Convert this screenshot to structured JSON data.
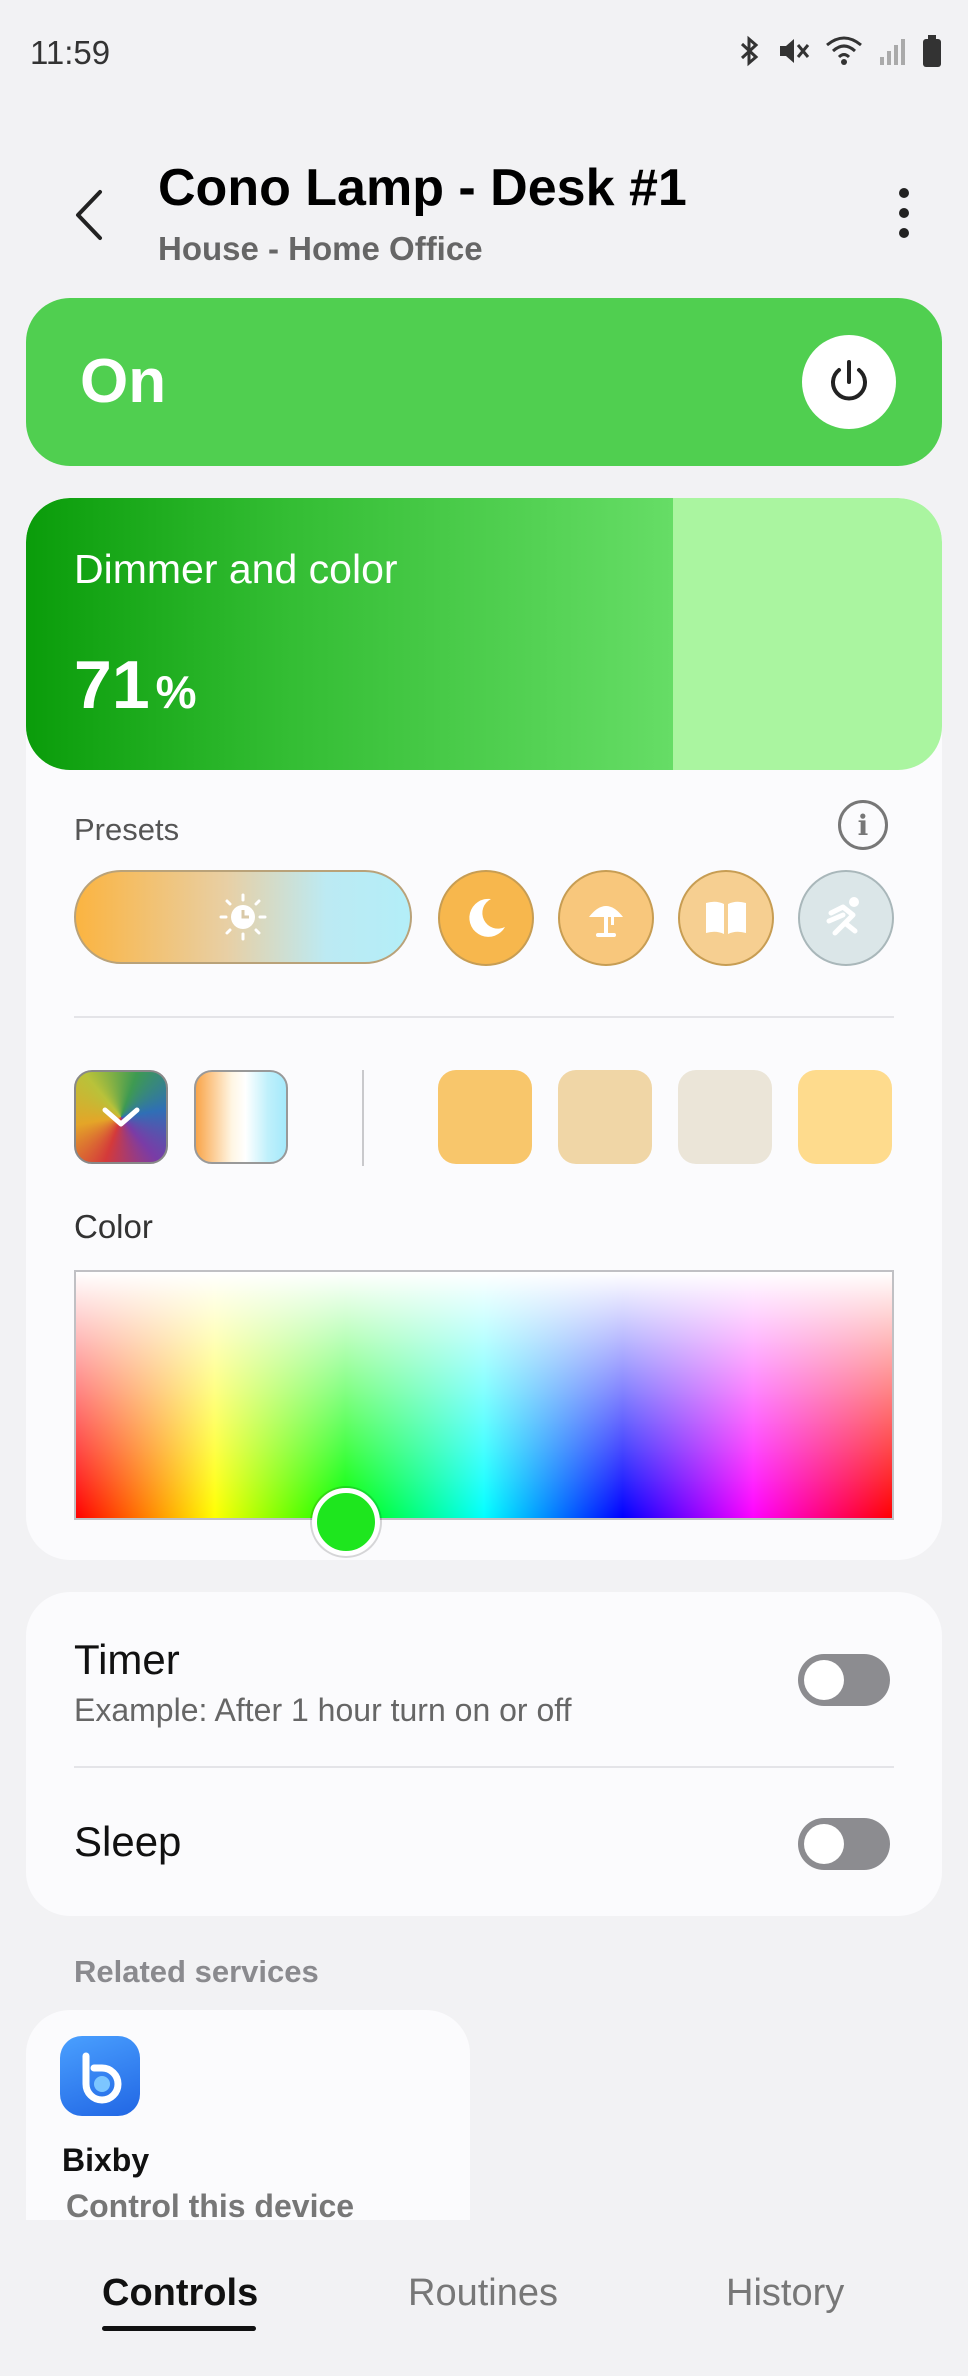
{
  "status_bar": {
    "time": "11:59",
    "icons": [
      "bluetooth-icon",
      "mute-icon",
      "wifi-icon",
      "signal-icon",
      "battery-icon"
    ]
  },
  "header": {
    "title": "Cono Lamp - Desk #1",
    "subtitle": "House - Home Office"
  },
  "power": {
    "state_label": "On",
    "accent_color": "#50cf50"
  },
  "dimmer": {
    "label": "Dimmer and color",
    "value": "71",
    "unit": "%",
    "level_fraction": 0.71
  },
  "presets": {
    "label": "Presets",
    "items": [
      {
        "icon": "sun-clock-icon",
        "selected": true
      },
      {
        "icon": "moon-icon"
      },
      {
        "icon": "lamp-icon"
      },
      {
        "icon": "book-icon"
      },
      {
        "icon": "running-person-icon"
      }
    ]
  },
  "swatches": {
    "recent_colors": [
      "#f8c66b",
      "#f0d6a6",
      "#ebe5d8",
      "#fedb8d"
    ]
  },
  "color_picker": {
    "label": "Color",
    "selected_color": "#1ee61e"
  },
  "timer": {
    "title": "Timer",
    "subtitle": "Example: After 1 hour turn on or off",
    "enabled": false
  },
  "sleep": {
    "title": "Sleep",
    "enabled": false
  },
  "related": {
    "label": "Related services",
    "service_name": "Bixby",
    "service_desc": "Control this device"
  },
  "bottom_nav": {
    "tabs": [
      "Controls",
      "Routines",
      "History"
    ],
    "active": "Controls"
  }
}
